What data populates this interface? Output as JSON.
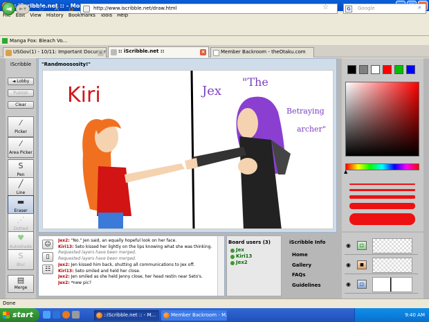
{
  "window": {
    "title": ":: iScribble.net :: - Mozilla Firefox"
  },
  "menu": [
    "File",
    "Edit",
    "View",
    "History",
    "Bookmarks",
    "Tools",
    "Help"
  ],
  "nav": {
    "url": "http://www.iscribble.net/draw.html",
    "search_placeholder": "Google"
  },
  "bookmarks": {
    "item": "Manga Fox: Bleach Vo..."
  },
  "tabs": [
    {
      "label": "USGov(1) - 10/11: Important Documen...",
      "active": false
    },
    {
      "label": ":: iScribble.net ::",
      "active": true
    },
    {
      "label": "Member Backroom - theOtaku.com",
      "active": false
    }
  ],
  "tools": {
    "header": "iScribble",
    "lobby": "◄ Lobby",
    "publish": "Publish",
    "clear": "Clear",
    "items": [
      {
        "label": "Picker",
        "icon": "eyedropper-icon"
      },
      {
        "label": "Area Picker",
        "icon": "area-picker-icon"
      },
      {
        "label": "Pen",
        "icon": "pen-icon"
      },
      {
        "label": "Line",
        "icon": "line-icon"
      },
      {
        "label": "Eraser",
        "icon": "eraser-icon"
      },
      {
        "label": "Dotted",
        "icon": "dotted-line-icon"
      },
      {
        "label": "Autoshade",
        "icon": "autoshade-icon"
      },
      {
        "label": "Blur",
        "icon": "blur-icon"
      },
      {
        "label": "Merge",
        "icon": "merge-icon"
      }
    ]
  },
  "canvas": {
    "title": "\"Randmoososity!\"",
    "text_left": "Kiri",
    "text_right_1": "Jex",
    "text_right_2": "\"The",
    "text_right_3": "Betraying",
    "text_right_4": "archer\""
  },
  "colors": {
    "swatches": [
      "#000000",
      "#808080",
      "#ffffff",
      "#ff0000",
      "#00c000",
      "#0000ff"
    ]
  },
  "chat": {
    "lines": [
      {
        "who": "Jex2:",
        "text": " \"No.\" Jen said, an equally hopeful look on her face."
      },
      {
        "who": "Kiri13:",
        "text": " Seto kissed her lightly on the lips knowing what she was thinking."
      },
      {
        "who": "",
        "text": "Requested layers have been merged."
      },
      {
        "who": "",
        "text": "Requested layers have been merged."
      },
      {
        "who": "Jex2:",
        "text": " Jen kissed him back, shutting all communications to Jex off."
      },
      {
        "who": "Kiri13:",
        "text": " Seto smiled and held her close."
      },
      {
        "who": "Jex2:",
        "text": " Jen smiled as she held Jenny close, her head restin near Seto's."
      },
      {
        "who": "Jex2:",
        "text": " *new pic?"
      }
    ]
  },
  "users": {
    "header": "Board users (3)",
    "list": [
      "Jex",
      "Kiri13",
      "Jex2"
    ]
  },
  "info": {
    "header": "iScribble Info",
    "links": [
      "Home",
      "Gallery",
      "FAQs",
      "Guidelines"
    ]
  },
  "status": {
    "text": "Done"
  },
  "taskbar": {
    "start": "start",
    "items": [
      {
        "label": "::iScribble.net :: - M...",
        "active": true
      },
      {
        "label": "Member Backroom - M...",
        "active": false
      }
    ],
    "clock": "9:40 AM"
  }
}
